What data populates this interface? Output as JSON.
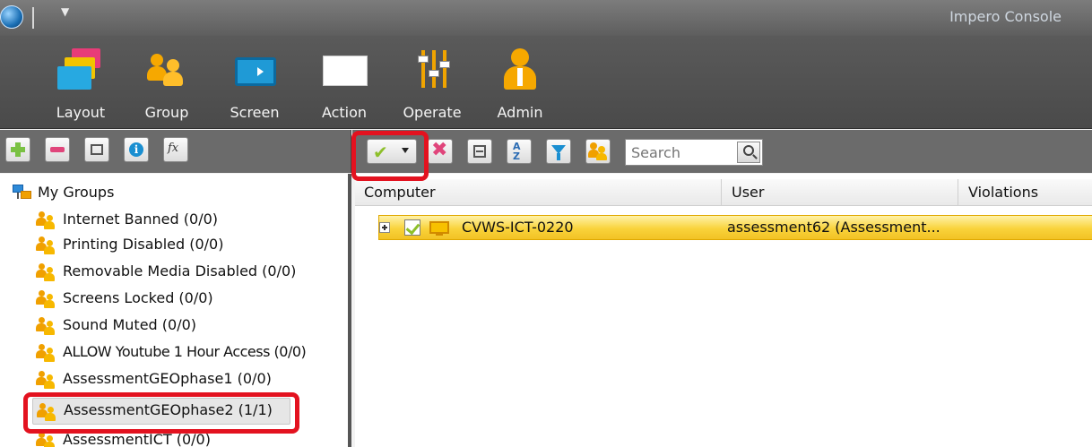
{
  "window": {
    "title": "Impero Console"
  },
  "ribbon": {
    "buttons": [
      {
        "id": "layout",
        "label": "Layout"
      },
      {
        "id": "group",
        "label": "Group"
      },
      {
        "id": "screen",
        "label": "Screen"
      },
      {
        "id": "action",
        "label": "Action"
      },
      {
        "id": "operate",
        "label": "Operate"
      },
      {
        "id": "admin",
        "label": "Admin"
      }
    ]
  },
  "left_toolbar": {
    "icons": [
      "add-group-icon",
      "remove-group-icon",
      "rename-icon",
      "info-icon",
      "function-icon"
    ],
    "fx_label": "fx",
    "info_label": "i"
  },
  "right_toolbar": {
    "icons": [
      "select-all-check-icon",
      "deselect-icon",
      "collapse-all-icon",
      "sort-icon",
      "filter-icon",
      "group-icon"
    ],
    "sort_label": "A\nZ",
    "search": {
      "placeholder": "Search",
      "value": ""
    }
  },
  "tree": {
    "root_label": "My Groups",
    "items": [
      {
        "label": "Internet Banned (0/0)"
      },
      {
        "label": "Printing Disabled (0/0)"
      },
      {
        "label": "Removable Media Disabled (0/0)"
      },
      {
        "label": "Screens Locked (0/0)"
      },
      {
        "label": "Sound Muted (0/0)"
      },
      {
        "label": "ALLOW Youtube 1 Hour Access (0/0)"
      },
      {
        "label": "AssessmentGEOphase1 (0/0)"
      },
      {
        "label": "AssessmentGEOphase2 (1/1)",
        "selected": true
      },
      {
        "label": "AssessmentICT (0/0)"
      }
    ]
  },
  "grid": {
    "columns": [
      "Computer",
      "User",
      "Violations"
    ],
    "rows": [
      {
        "computer": "CVWS-ICT-0220",
        "user": "assessment62 (Assessment...",
        "violations": ""
      }
    ]
  },
  "colors": {
    "highlight": "#e3121f",
    "selected_row": "#f9d33b",
    "ribbon": "#4a4a4a"
  }
}
